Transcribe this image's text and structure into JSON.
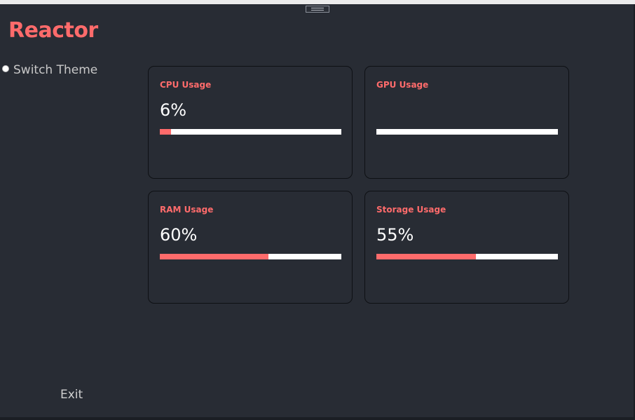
{
  "app": {
    "title": "Reactor",
    "switch_theme_label": "Switch Theme",
    "exit_label": "Exit"
  },
  "colors": {
    "accent": "#ff6b6b",
    "background": "#282c34",
    "bar_track": "#ffffff"
  },
  "cards": [
    {
      "title": "CPU Usage",
      "value_text": "6%",
      "percent": 6
    },
    {
      "title": "GPU Usage",
      "value_text": "",
      "percent": 0
    },
    {
      "title": "RAM Usage",
      "value_text": "60%",
      "percent": 60
    },
    {
      "title": "Storage Usage",
      "value_text": "55%",
      "percent": 55
    }
  ]
}
